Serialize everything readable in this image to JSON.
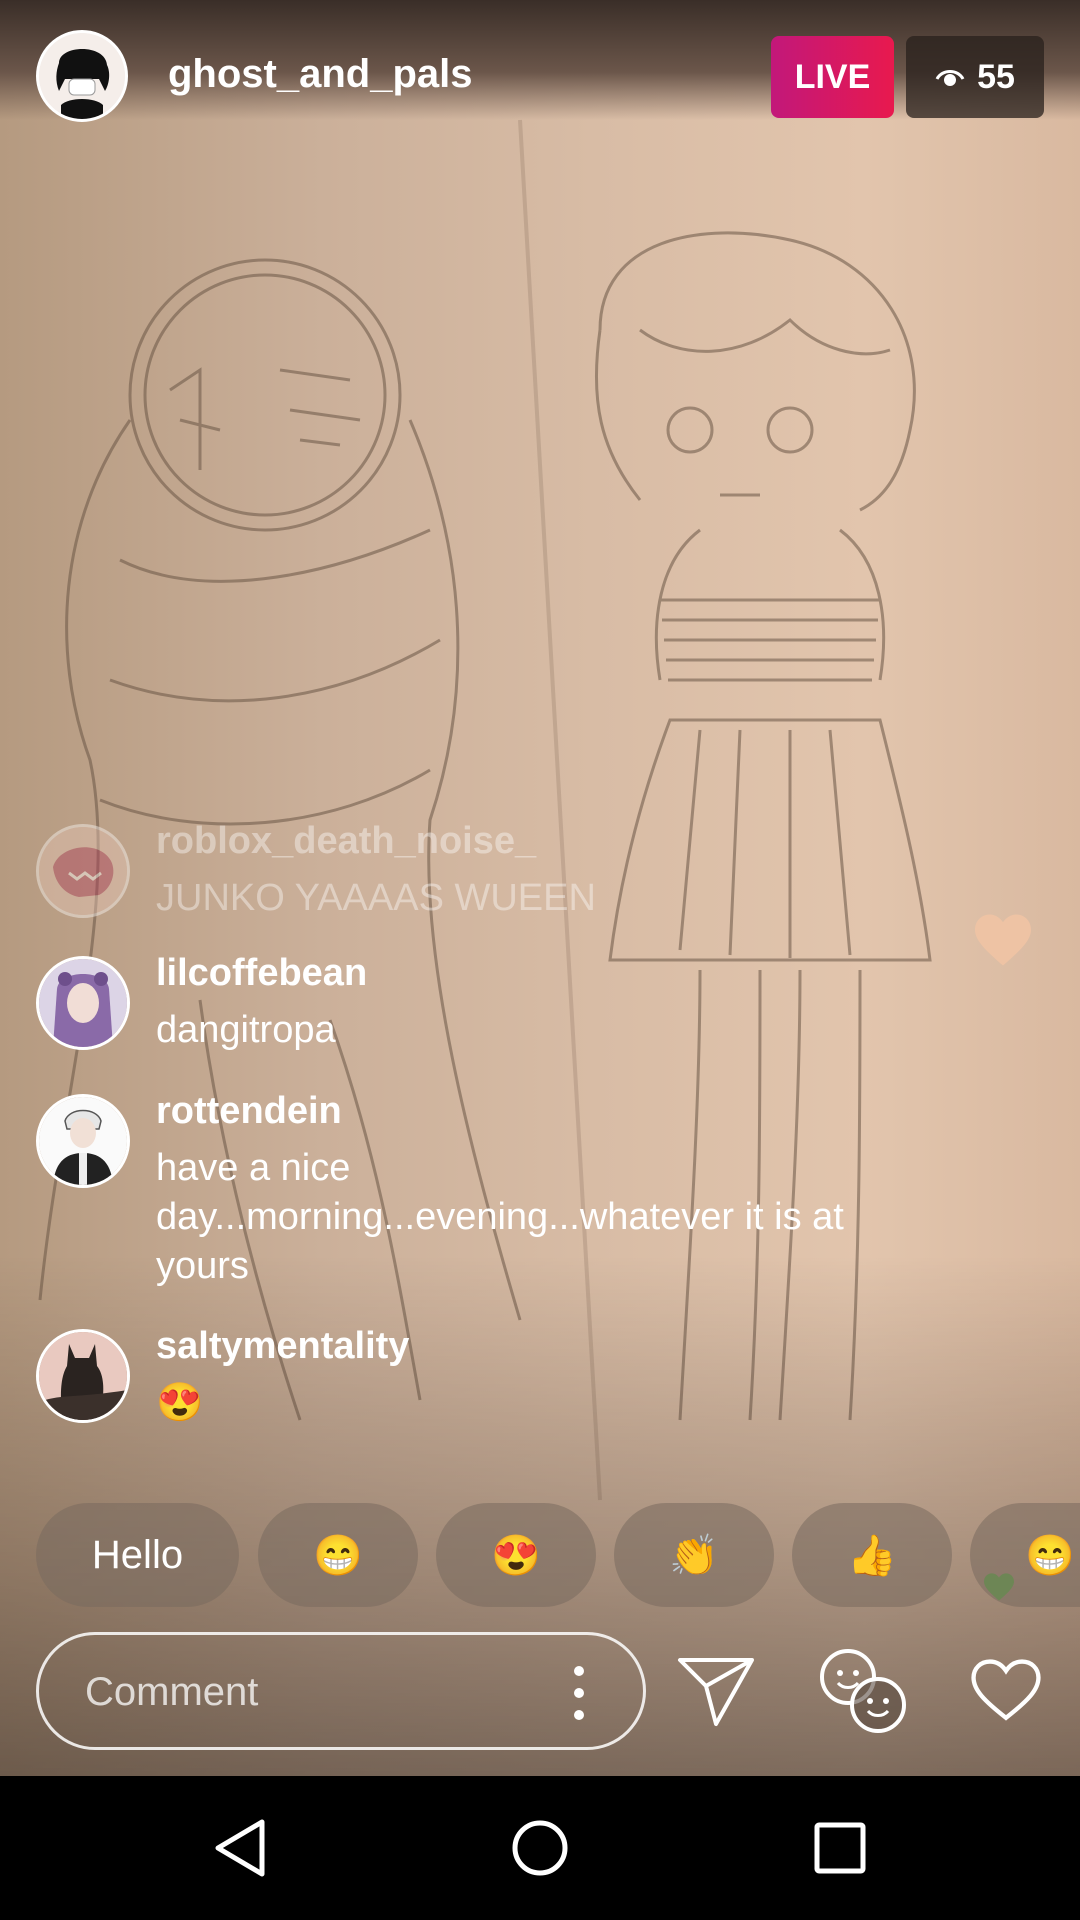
{
  "stream": {
    "username": "ghost_and_pals",
    "live_label": "LIVE",
    "viewer_count": "55"
  },
  "comments": [
    {
      "user": "roblox_death_noise_",
      "text": "JUNKO YAAAAS WUEEN"
    },
    {
      "user": "lilcoffebean",
      "text": "dangitropa"
    },
    {
      "user": "rottendein",
      "text": "have a nice day...morning...evening...whatever it is at yours"
    },
    {
      "user": "saltymentality",
      "text": "😍"
    }
  ],
  "quick_replies": [
    "Hello",
    "😁",
    "😍",
    "👏",
    "👍",
    "😁"
  ],
  "comment_input": {
    "placeholder": "Comment"
  },
  "icons": {
    "viewers": "eye-icon",
    "comment_options": "more-vertical-icon",
    "send": "paper-plane-icon",
    "add_guest": "faces-icon",
    "like": "heart-icon",
    "nav_back": "back-triangle-icon",
    "nav_home": "home-circle-icon",
    "nav_recents": "recents-square-icon"
  },
  "colors": {
    "live_badge": "#e8194e",
    "viewers_bg": "#282019",
    "floating_heart_green": "#5fa84a",
    "floating_heart_peach": "#f2c4a4"
  }
}
